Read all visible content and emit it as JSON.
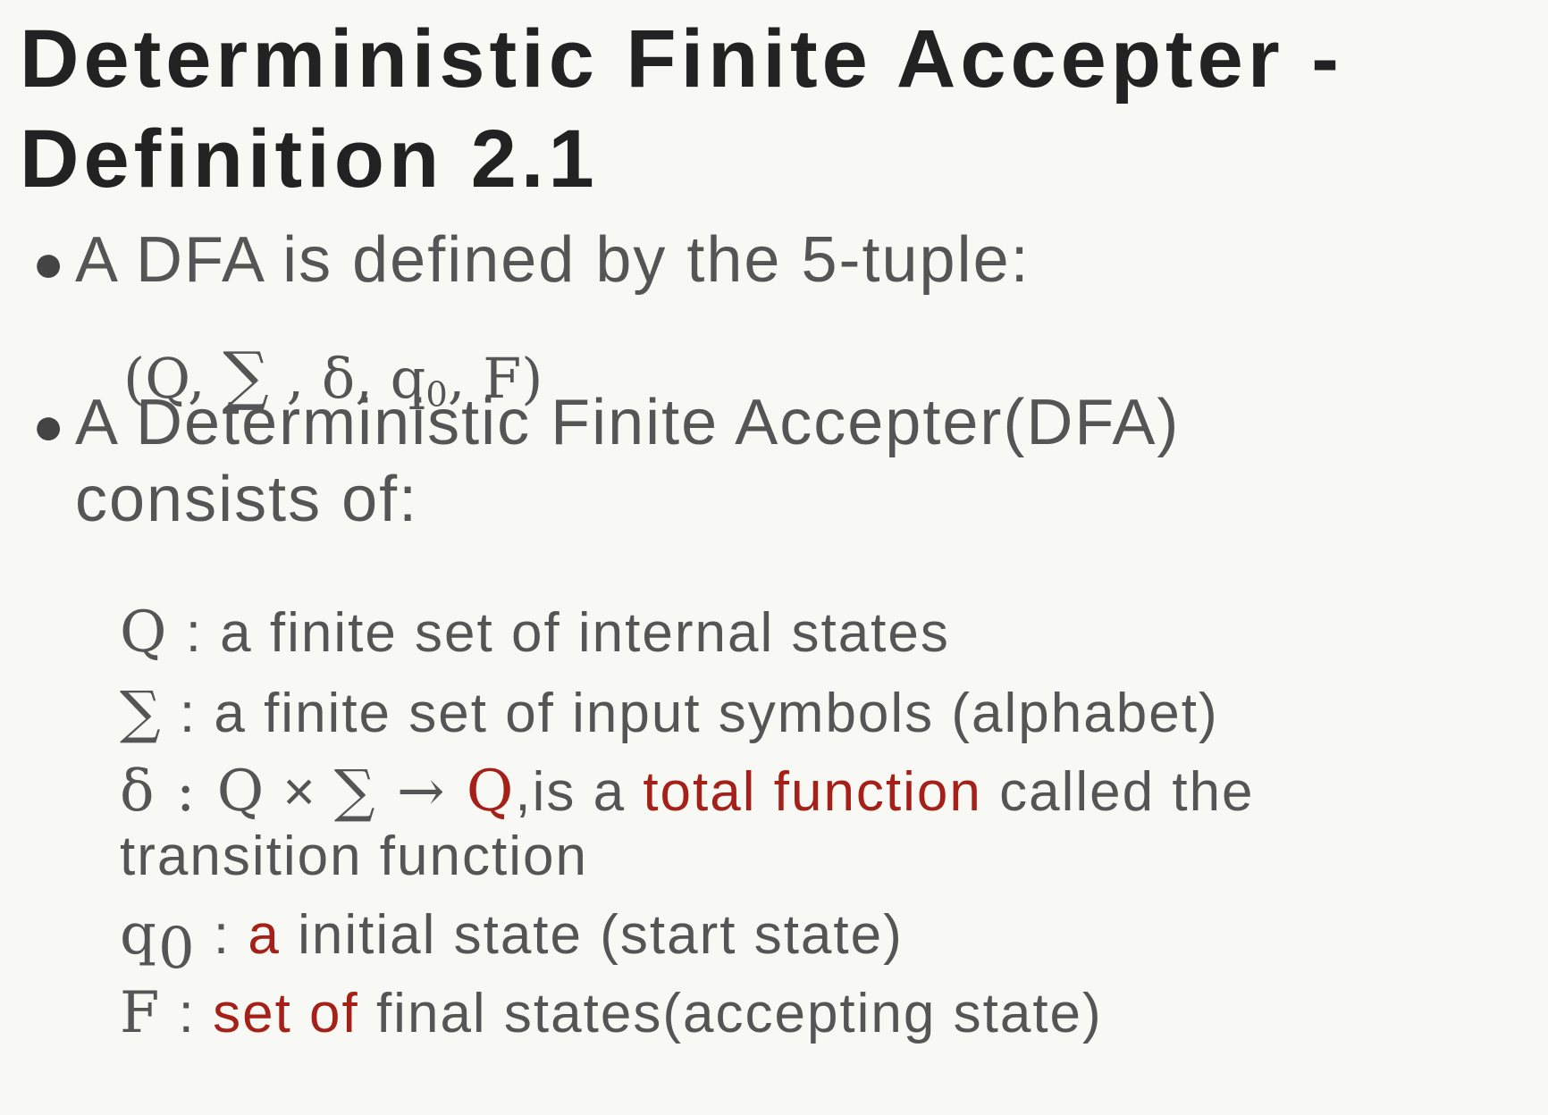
{
  "slide": {
    "title": "Deterministic Finite Accepter - Definition 2.1",
    "bullet1": {
      "text": "A DFA is defined by the 5-tuple:",
      "tuple": {
        "open": "(Q, ",
        "sigma": "∑",
        "rest": " , δ, q",
        "sub": "0",
        "close": ", F)"
      }
    },
    "bullet2": {
      "line1": "A Deterministic Finite Accepter(DFA)",
      "line2": "consists of:"
    },
    "definitions": {
      "Q": {
        "symbol": "Q",
        "text": " : a finite set of internal states"
      },
      "Sigma": {
        "symbol": "∑",
        "text": " : a finite set of input symbols (alphabet)"
      },
      "delta": {
        "symbol": "δ : ",
        "q": "Q",
        "times": " × ",
        "sigma": "∑",
        "arrow": " → ",
        "q_red": "Q",
        "text_a": ",is a ",
        "red": "total function",
        "text_b": " called the",
        "line2": "transition function"
      },
      "q0": {
        "symbol": "q",
        "sub": "0",
        "text_a": " : ",
        "red": "a",
        "text_b": " initial state (start state)"
      },
      "F": {
        "symbol": "F",
        "text_a": " : ",
        "red": "set of",
        "text_b": " final states(accepting state)"
      }
    }
  },
  "colors": {
    "background": "#f8f9f4",
    "title": "#222222",
    "body_text": "#555555",
    "highlight": "#a52019"
  }
}
